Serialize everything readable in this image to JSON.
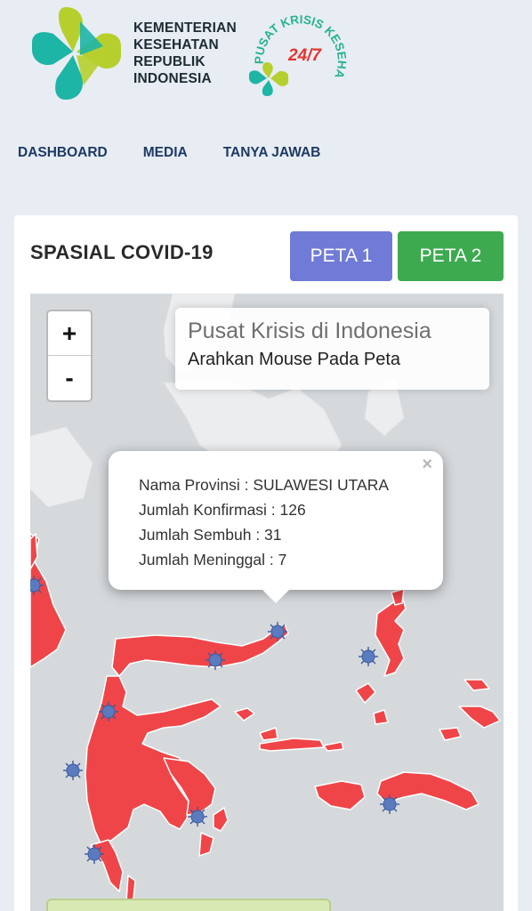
{
  "header": {
    "ministry_lines": [
      "KEMENTERIAN",
      "KESEHATAN",
      "REPUBLIK",
      "INDONESIA"
    ],
    "badge_arc_text": "PUSAT KRISIS KESEHATAN",
    "badge_number": "24/7"
  },
  "nav": {
    "items": [
      {
        "label": "DASHBOARD"
      },
      {
        "label": "MEDIA"
      },
      {
        "label": "TANYA JAWAB"
      }
    ]
  },
  "card": {
    "title": "SPASIAL COVID-19",
    "buttons": {
      "peta1": "PETA 1",
      "peta2": "PETA 2"
    }
  },
  "map": {
    "zoom": {
      "in": "+",
      "out": "-"
    },
    "info": {
      "title": "Pusat Krisis di Indonesia",
      "subtitle": "Arahkan Mouse Pada Peta"
    },
    "popup": {
      "close": "×",
      "province": "Nama Provinsi : SULAWESI UTARA",
      "confirmed": "Jumlah Konfirmasi : 126",
      "recovered": "Jumlah Sembuh : 31",
      "deaths": "Jumlah Meninggal : 7"
    },
    "marker_icon": "virus-icon"
  },
  "colors": {
    "background": "#e8ecf3",
    "nav_text": "#1d3a63",
    "peta1": "#6f7bd6",
    "peta2": "#3daa50",
    "province_fill": "#f04548",
    "map_water": "#d5d9dc",
    "logo_teal": "#1db5a5",
    "logo_green": "#b6cf2d"
  }
}
